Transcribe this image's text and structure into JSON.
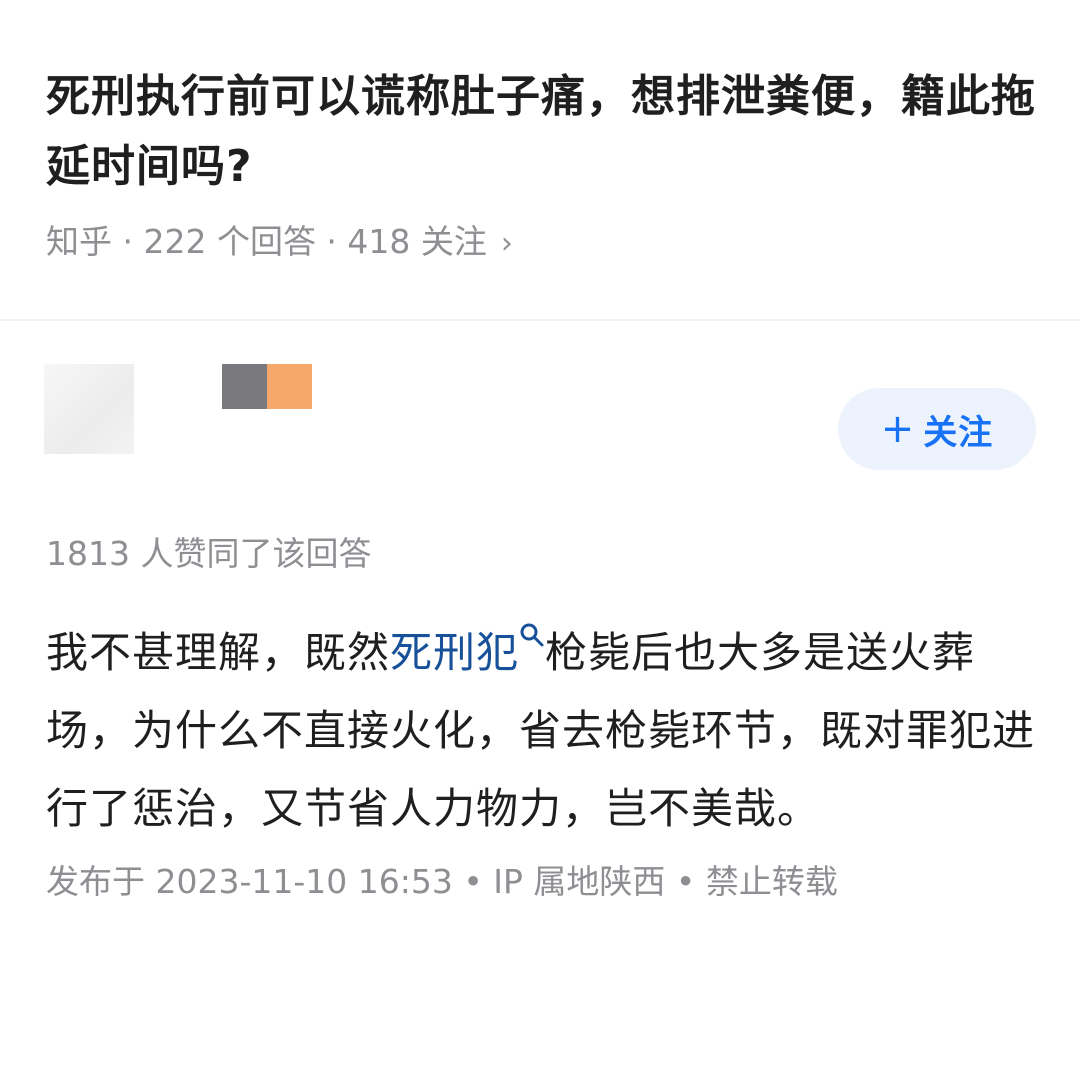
{
  "question": {
    "title": "死刑执行前可以谎称肚子痛，想排泄粪便，籍此拖延时间吗?",
    "meta": "知乎 · 222 个回答 · 418 关注",
    "meta_chevron": "›"
  },
  "answer": {
    "follow_plus": "+",
    "follow_label": "关注",
    "vote_text": "1813 人赞同了该回答",
    "body_before": "我不甚理解，既然",
    "body_keyword": "死刑犯",
    "body_after": "枪毙后也大多是送火葬场，为什么不直接火化，省去枪毙环节，既对罪犯进行了惩治，又节省人力物力，岂不美哉。",
    "publish_info": "发布于 2023-11-10 16:53 • IP 属地陕西 • 禁止转载"
  },
  "colors": {
    "accent": "#1772f6",
    "keyword_link": "#175199",
    "muted_text": "#8e8e93",
    "primary_text": "#1f1f1f",
    "follow_bg": "#edf3fc",
    "badge_gray": "#7a7a7e",
    "badge_orange": "#f5a86a"
  },
  "icons": {
    "keyword_search": "search-icon",
    "meta_chevron": "chevron-right-icon",
    "follow_plus": "plus-icon"
  }
}
